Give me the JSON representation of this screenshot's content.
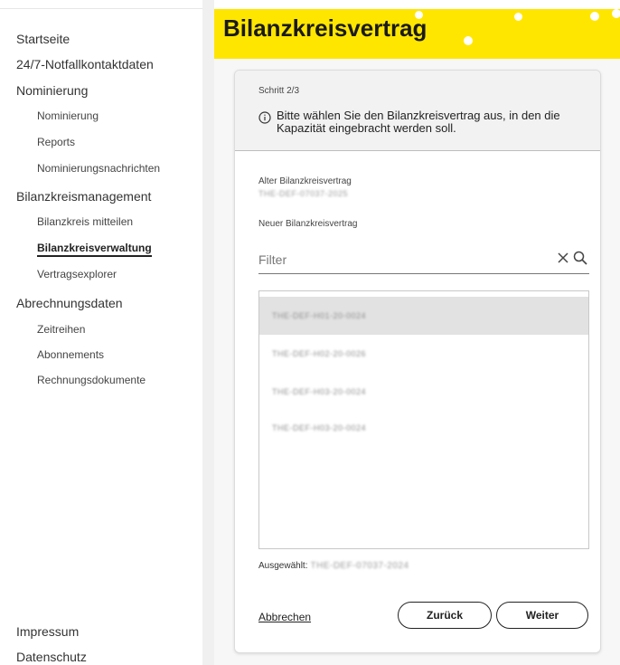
{
  "sidebar": {
    "items": [
      {
        "label": "Startseite",
        "level": 1
      },
      {
        "label": "24/7-Notfallkontaktdaten",
        "level": 1
      },
      {
        "label": "Nominierung",
        "level": 1
      },
      {
        "label": "Nominierung",
        "level": 2
      },
      {
        "label": "Reports",
        "level": 2
      },
      {
        "label": "Nominierungsnachrichten",
        "level": 2
      },
      {
        "label": "Bilanzkreismanagement",
        "level": 1
      },
      {
        "label": "Bilanzkreis mitteilen",
        "level": 2
      },
      {
        "label": "Bilanzkreisverwaltung",
        "level": 2,
        "active": true
      },
      {
        "label": "Vertragsexplorer",
        "level": 2
      },
      {
        "label": "Abrechnungsdaten",
        "level": 1
      },
      {
        "label": "Zeitreihen",
        "level": 2
      },
      {
        "label": "Abonnements",
        "level": 2
      },
      {
        "label": "Rechnungsdokumente",
        "level": 2
      }
    ],
    "footer": {
      "impressum": "Impressum",
      "datenschutz": "Datenschutz"
    }
  },
  "header": {
    "title": "Bilanzkreisvertrag",
    "background": "#ffe600"
  },
  "wizard": {
    "step": "Schritt 2/3",
    "info": "Bitte wählen Sie den Bilanzkreisvertrag aus, in den die Kapazität eingebracht werden soll.",
    "old_label": "Alter Bilanzkreisvertrag",
    "old_value": "THE-DEF-07037-2025",
    "new_label": "Neuer Bilanzkreisvertrag",
    "filter": {
      "placeholder": "Filter",
      "value": ""
    },
    "options": [
      {
        "label": "THE-DEF-H01-20-0024",
        "selected": true
      },
      {
        "label": "THE-DEF-H02-20-0026",
        "selected": false
      },
      {
        "label": "THE-DEF-H03-20-0024",
        "selected": false
      },
      {
        "label": "THE-DEF-H03-20-0024",
        "selected": false
      }
    ],
    "selected_label": "Ausgewählt:",
    "selected_value": "THE-DEF-07037-2024",
    "cancel": "Abbrechen",
    "back": "Zurück",
    "next": "Weiter"
  },
  "icons": {
    "info": "info-circle-icon",
    "clear": "close-icon",
    "search": "search-icon"
  }
}
